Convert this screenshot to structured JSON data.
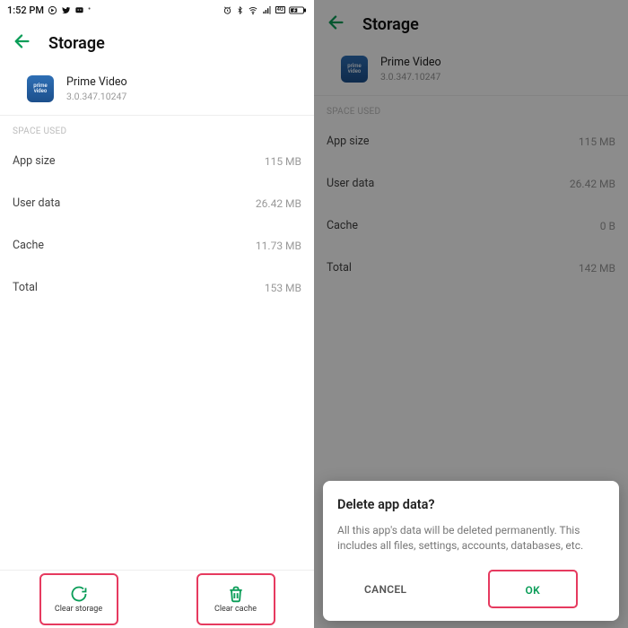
{
  "statusbar": {
    "time": "1:52 PM"
  },
  "header": {
    "title": "Storage"
  },
  "app": {
    "name": "Prime Video",
    "version": "3.0.347.10247",
    "icon_text": "prime\nvideo"
  },
  "section": {
    "space_used": "SPACE USED"
  },
  "left": {
    "rows": [
      {
        "label": "App size",
        "value": "115 MB"
      },
      {
        "label": "User data",
        "value": "26.42 MB"
      },
      {
        "label": "Cache",
        "value": "11.73 MB"
      },
      {
        "label": "Total",
        "value": "153 MB"
      }
    ],
    "buttons": {
      "clear_storage": "Clear storage",
      "clear_cache": "Clear cache"
    }
  },
  "right": {
    "rows": [
      {
        "label": "App size",
        "value": "115 MB"
      },
      {
        "label": "User data",
        "value": "26.42 MB"
      },
      {
        "label": "Cache",
        "value": "0 B"
      },
      {
        "label": "Total",
        "value": "142 MB"
      }
    ]
  },
  "dialog": {
    "title": "Delete app data?",
    "message": "All this app's data will be deleted permanently. This includes all files, settings, accounts, databases, etc.",
    "cancel": "CANCEL",
    "ok": "OK"
  }
}
